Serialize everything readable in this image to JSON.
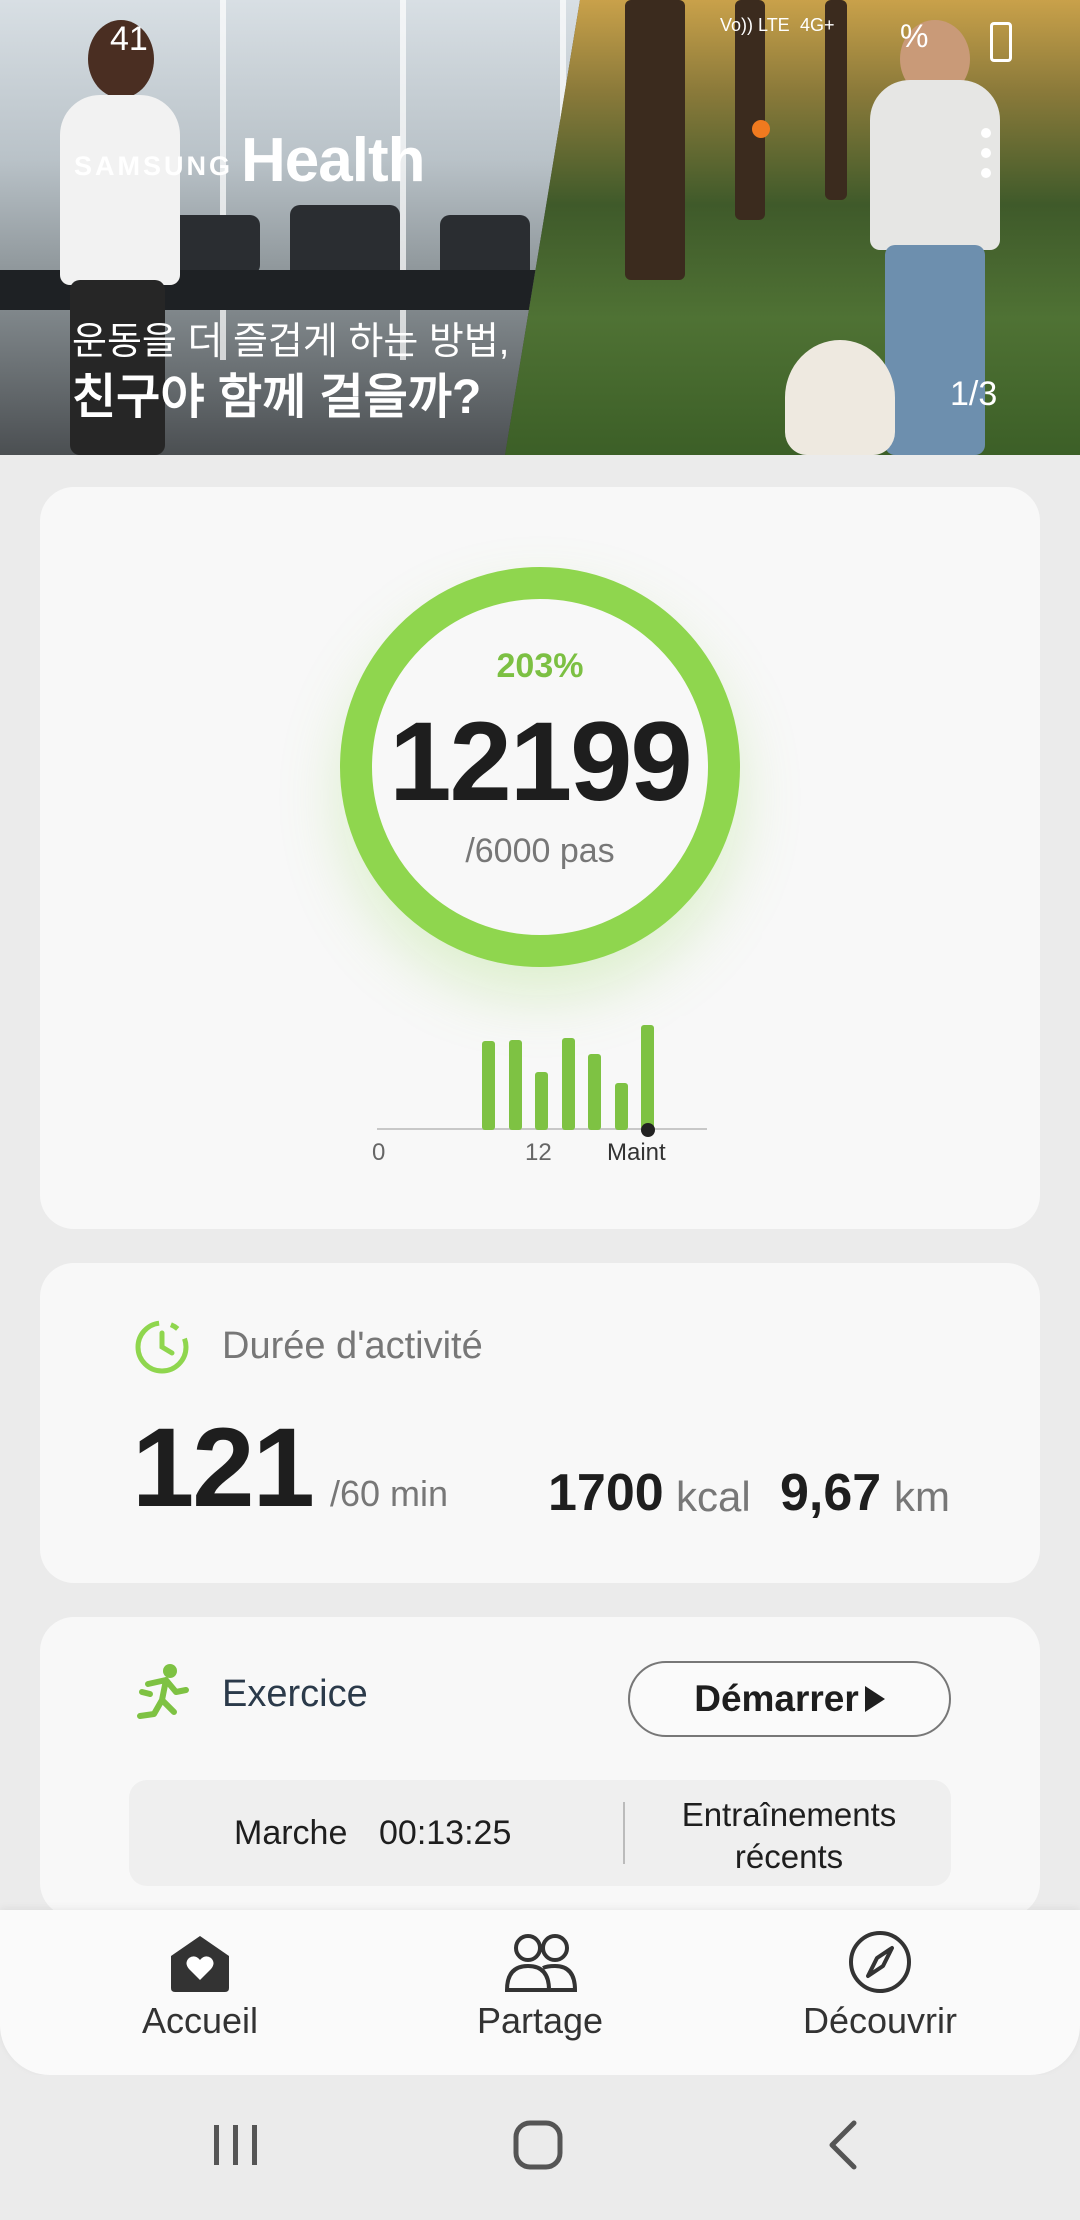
{
  "status_bar": {
    "time": "41",
    "network_1": "Vo)) LTE",
    "network_2": "4G+",
    "battery": "%"
  },
  "banner": {
    "brand_samsung": "SAMSUNG",
    "brand_health": "Health",
    "promo_line1": "운동을 더 즐겁게 하는 방법,",
    "promo_line2": "친구야 함께 걸을까?",
    "page_counter": "1/3",
    "indicator_color": "#f07a1f"
  },
  "steps_card": {
    "percent": "203%",
    "steps": "12199",
    "goal": "/6000 pas",
    "progress_fraction": 2.03,
    "ring_color": "#8fd64e",
    "mini_chart": {
      "type": "bar",
      "values": [
        0.85,
        0.86,
        0.55,
        0.88,
        0.72,
        0.45,
        1.0
      ],
      "tick_labels": [
        "0",
        "12",
        "Maint"
      ]
    }
  },
  "activity_card": {
    "icon": "timer-icon",
    "title": "Durée d'activité",
    "value": "121",
    "goal": "/60 min",
    "kcal_value": "1700",
    "kcal_unit": "kcal",
    "km_value": "9,67",
    "km_unit": "km"
  },
  "exercise_card": {
    "icon": "running-icon",
    "title": "Exercice",
    "start_label": "Démarrer",
    "workout_name": "Marche",
    "workout_time": "00:13:25",
    "recent_label": "Entraînements récents"
  },
  "bottom_nav": {
    "items": [
      {
        "label": "Accueil",
        "icon": "home-heart-icon"
      },
      {
        "label": "Partage",
        "icon": "people-icon"
      },
      {
        "label": "Découvrir",
        "icon": "compass-icon"
      }
    ]
  },
  "system_nav": {
    "icons": [
      "recent-apps-icon",
      "home-icon",
      "back-icon"
    ]
  }
}
